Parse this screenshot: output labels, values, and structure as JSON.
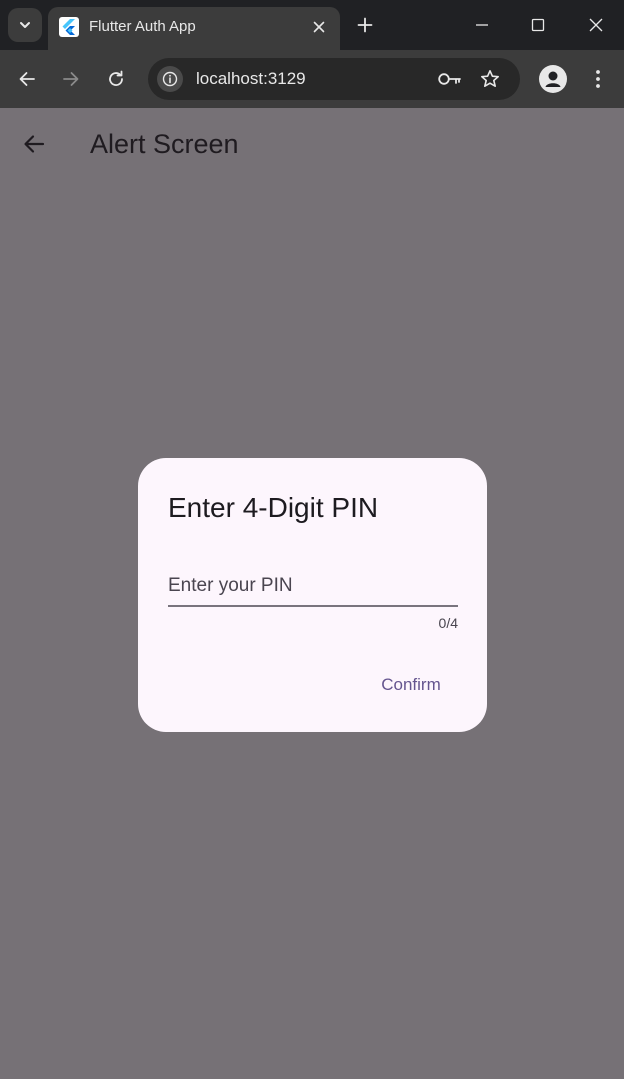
{
  "browser": {
    "tab_title": "Flutter Auth App",
    "url": "localhost:3129",
    "icons": {
      "tab_search": "chevron-down-icon",
      "favicon": "flutter-logo-icon",
      "tab_close": "close-icon",
      "new_tab": "plus-icon",
      "minimize": "minimize-icon",
      "maximize": "maximize-icon",
      "window_close": "close-icon",
      "back": "arrow-left-icon",
      "forward": "arrow-right-icon",
      "reload": "reload-icon",
      "site_info": "info-icon",
      "password": "key-icon",
      "bookmark": "star-icon",
      "profile": "person-icon",
      "menu": "kebab-menu-icon"
    }
  },
  "app": {
    "title": "Alert Screen",
    "back_icon": "arrow-left-icon",
    "scrim_color": "#767176"
  },
  "dialog": {
    "title": "Enter 4-Digit PIN",
    "pin_placeholder": "Enter your PIN",
    "pin_value": "",
    "counter": "0/4",
    "confirm_label": "Confirm",
    "surface_color": "#fdf6fd",
    "accent_color": "#65558f"
  }
}
